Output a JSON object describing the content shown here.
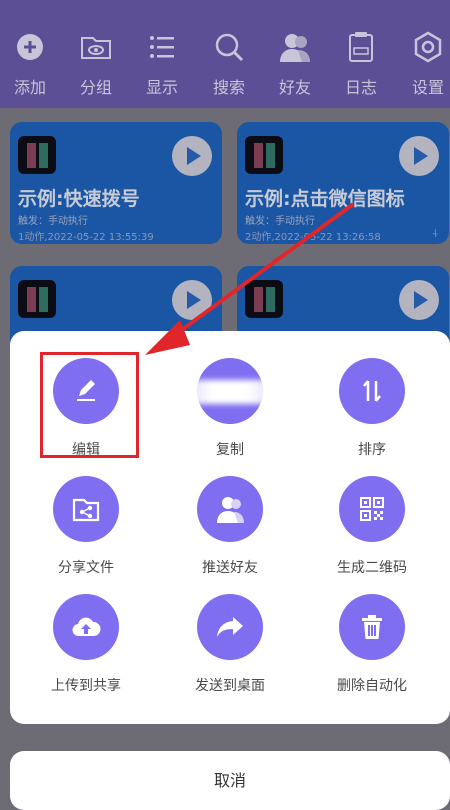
{
  "toolbar": {
    "items": [
      {
        "label": "添加",
        "icon": "add-icon"
      },
      {
        "label": "分组",
        "icon": "folder-eye-icon"
      },
      {
        "label": "显示",
        "icon": "list-icon"
      },
      {
        "label": "搜索",
        "icon": "search-icon"
      },
      {
        "label": "好友",
        "icon": "friends-icon"
      },
      {
        "label": "日志",
        "icon": "log-icon"
      },
      {
        "label": "设置",
        "icon": "settings-icon"
      }
    ]
  },
  "cards": [
    {
      "title": "示例:快速拨号",
      "trigger": "触发：手动执行",
      "meta": "1动作,2022-05-22 13:55:39"
    },
    {
      "title": "示例:点击微信图标",
      "trigger": "触发：手动执行",
      "meta": "2动作,2022-05-22 13:26:58"
    }
  ],
  "sheet": {
    "actions": [
      {
        "label": "编辑",
        "icon": "edit-icon"
      },
      {
        "label": "复制",
        "icon": "copy-icon"
      },
      {
        "label": "排序",
        "icon": "sort-icon"
      },
      {
        "label": "分享文件",
        "icon": "share-file-icon"
      },
      {
        "label": "推送好友",
        "icon": "push-friend-icon"
      },
      {
        "label": "生成二维码",
        "icon": "qrcode-icon"
      },
      {
        "label": "上传到共享",
        "icon": "cloud-upload-icon"
      },
      {
        "label": "发送到桌面",
        "icon": "forward-icon"
      },
      {
        "label": "删除自动化",
        "icon": "trash-icon"
      }
    ],
    "cancel_label": "取消"
  },
  "colors": {
    "toolbar_bg": "#5c4f95",
    "card_bg": "#1a56a4",
    "action_circle": "#7f6ef0",
    "annotation_red": "#e0262b"
  }
}
